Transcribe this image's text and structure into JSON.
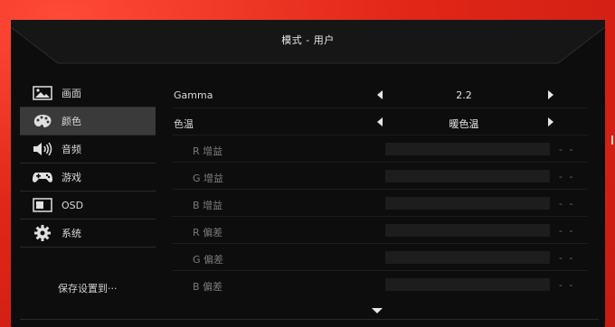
{
  "header": {
    "title": "模式 - 用户"
  },
  "sidebar": {
    "items": [
      {
        "label": "画面",
        "icon": "picture-icon"
      },
      {
        "label": "颜色",
        "icon": "palette-icon",
        "selected": true
      },
      {
        "label": "音频",
        "icon": "speaker-icon"
      },
      {
        "label": "游戏",
        "icon": "gamepad-icon"
      },
      {
        "label": "OSD",
        "icon": "osd-icon"
      },
      {
        "label": "系统",
        "icon": "gear-icon"
      }
    ],
    "save_label": "保存设置到···"
  },
  "main": {
    "gamma": {
      "label": "Gamma",
      "value": "2.2"
    },
    "color_temp": {
      "label": "色温",
      "value": "暖色温"
    },
    "adjustments": [
      {
        "label": "R 增益",
        "value": "- -"
      },
      {
        "label": "G 增益",
        "value": "- -"
      },
      {
        "label": "B 增益",
        "value": "- -"
      },
      {
        "label": "R 偏差",
        "value": "- -"
      },
      {
        "label": "G 偏差",
        "value": "- -"
      },
      {
        "label": "B 偏差",
        "value": "- -"
      }
    ]
  },
  "colors": {
    "background": "#e8281c",
    "panel": "#0d0d0d",
    "selected": "#3a3a3a"
  }
}
